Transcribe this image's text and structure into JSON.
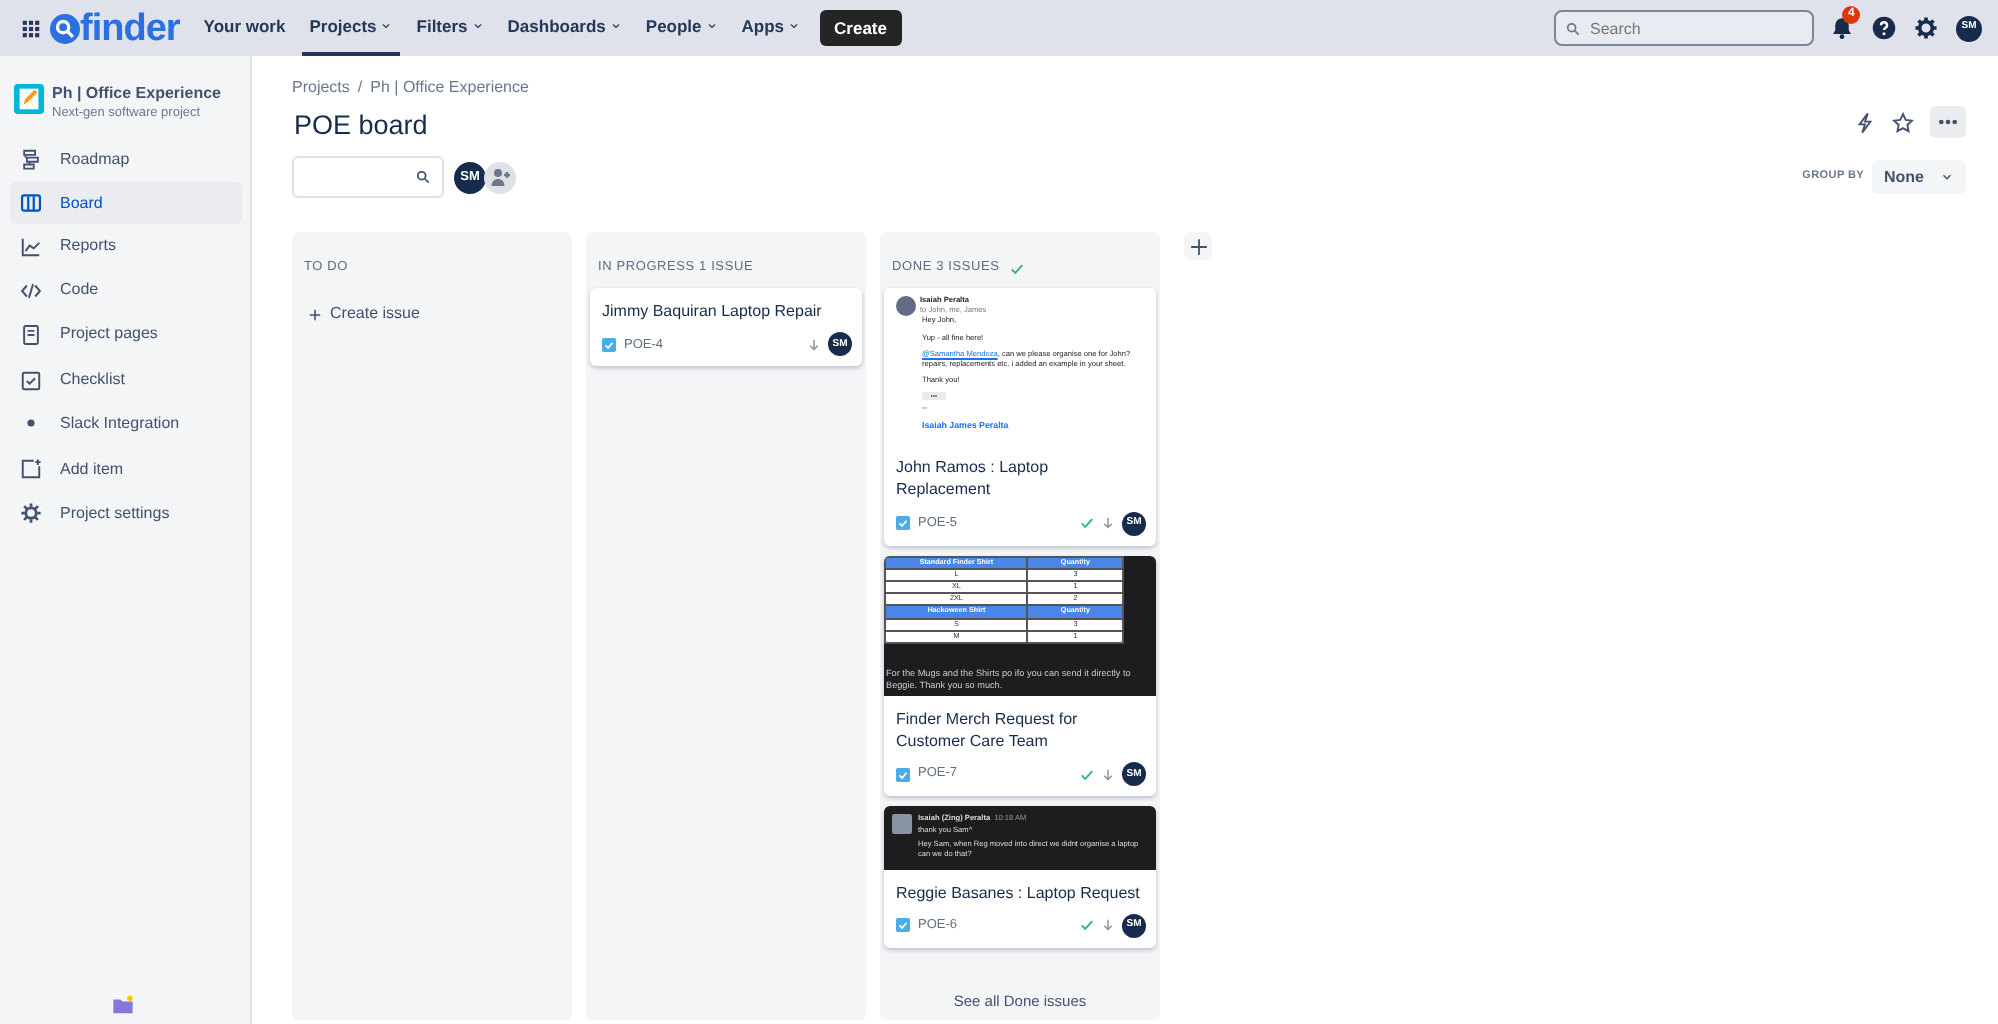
{
  "topnav": {
    "logo": "finder",
    "items": [
      {
        "label": "Your work",
        "dropdown": false,
        "selected": false
      },
      {
        "label": "Projects",
        "dropdown": true,
        "selected": true
      },
      {
        "label": "Filters",
        "dropdown": true,
        "selected": false
      },
      {
        "label": "Dashboards",
        "dropdown": true,
        "selected": false
      },
      {
        "label": "People",
        "dropdown": true,
        "selected": false
      },
      {
        "label": "Apps",
        "dropdown": true,
        "selected": false
      }
    ],
    "create": "Create",
    "search": {
      "placeholder": "Search"
    },
    "notification_count": "4",
    "avatar": "SM"
  },
  "sidebar": {
    "project_name": "Ph | Office Experience",
    "project_type": "Next-gen software project",
    "items": [
      {
        "kind": "roadmap",
        "label": "Roadmap",
        "selected": false
      },
      {
        "kind": "board",
        "label": "Board",
        "selected": true
      },
      {
        "kind": "reports",
        "label": "Reports",
        "selected": false
      },
      {
        "kind": "code",
        "label": "Code",
        "selected": false
      },
      {
        "kind": "pages",
        "label": "Project pages",
        "selected": false
      },
      {
        "kind": "checklist",
        "label": "Checklist",
        "selected": false
      },
      {
        "kind": "slack",
        "label": "Slack Integration",
        "selected": false
      },
      {
        "kind": "add",
        "label": "Add item",
        "selected": false
      },
      {
        "kind": "settings",
        "label": "Project settings",
        "selected": false
      }
    ]
  },
  "breadcrumbs": {
    "items": [
      "Projects",
      "Ph | Office Experience"
    ],
    "separator": "/"
  },
  "title": "POE board",
  "filter_avatar": "SM",
  "group_by": {
    "label": "GROUP BY",
    "value": "None"
  },
  "columns": [
    {
      "title": "TO DO",
      "done": false,
      "create_issue": "Create issue"
    },
    {
      "title": "IN PROGRESS 1 ISSUE",
      "done": false,
      "cards": [
        {
          "title": "Jimmy Baquiran Laptop Repair",
          "key": "POE-4",
          "done": false,
          "avatar": "SM"
        }
      ]
    },
    {
      "title": "DONE 3 ISSUES",
      "done": true,
      "footer": "See all Done issues",
      "cards": [
        {
          "title": "John Ramos : Laptop Replacement",
          "key": "POE-5",
          "done": true,
          "avatar": "SM",
          "attachment": {
            "kind": "email",
            "sender": "Isaiah Peralta",
            "recipients": "to John, me, James",
            "paragraphs": [
              {
                "text": "Hey John,"
              },
              {
                "text": "Yup - all fine here!"
              },
              {
                "mention": "@Samantha Mendoza",
                "text": ", can we please organise one for John? repairs, replacements etc. i added an example in your sheet."
              },
              {
                "text": "Thank you!"
              }
            ],
            "ellipsis": "•••",
            "separator": "--",
            "signature": "Isaiah James Peralta"
          }
        },
        {
          "title": "Finder Merch Request for Customer Care Team",
          "key": "POE-7",
          "done": true,
          "avatar": "SM",
          "attachment": {
            "kind": "table",
            "rows": [
              {
                "header": true,
                "cells": [
                  "Standard Finder Shirt",
                  "Quantity"
                ]
              },
              {
                "header": false,
                "cells": [
                  "L",
                  "3"
                ]
              },
              {
                "header": false,
                "cells": [
                  "XL",
                  "1"
                ]
              },
              {
                "header": false,
                "cells": [
                  "2XL",
                  "2"
                ]
              },
              {
                "header": true,
                "cells": [
                  "Hackoween Shirt",
                  "Quantity"
                ]
              },
              {
                "header": false,
                "cells": [
                  "S",
                  "3"
                ]
              },
              {
                "header": false,
                "cells": [
                  "M",
                  "1"
                ]
              }
            ],
            "caption": "For the Mugs and the Shirts po ifo you can send it directly to Beggie. Thank you so much."
          }
        },
        {
          "title": "Reggie Basanes : Laptop Request",
          "key": "POE-6",
          "done": true,
          "avatar": "SM",
          "attachment": {
            "kind": "chat",
            "sender": "Isaiah (Zing) Peralta",
            "time": "10:18 AM",
            "lines": [
              "thank you Sam^",
              "Hey Sam, when Reg moved into direct we didnt organise a laptop can we do that?"
            ]
          }
        }
      ]
    }
  ]
}
